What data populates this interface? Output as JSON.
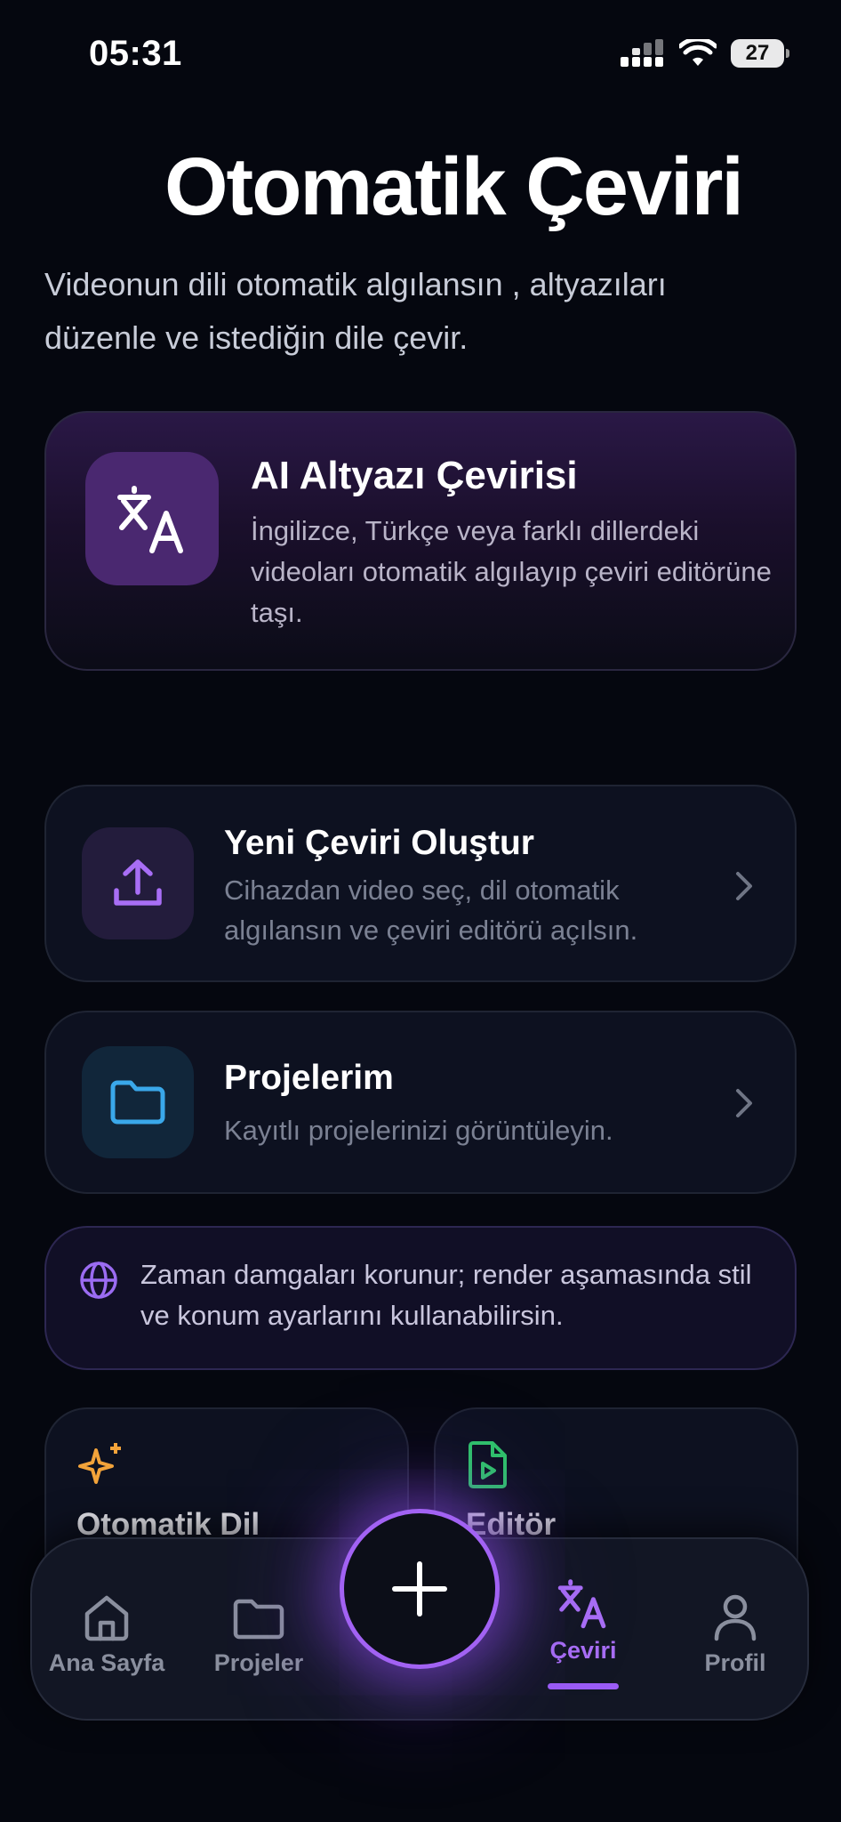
{
  "status": {
    "time": "05:31",
    "battery": "27"
  },
  "header": {
    "title": "Otomatik Çeviri",
    "subtitle": "Videonun dili otomatik algılansın , altyazıları düzenle ve istediğin dile çevir."
  },
  "hero": {
    "title": "AI Altyazı Çevirisi",
    "description": "İngilizce, Türkçe veya farklı dillerdeki videoları otomatik algılayıp çeviri editörüne taşı.",
    "icon": "translate-icon"
  },
  "actions": [
    {
      "title": "Yeni Çeviri Oluştur",
      "description": "Cihazdan video seç, dil otomatik algılansın ve çeviri editörü açılsın.",
      "icon": "upload-icon"
    },
    {
      "title": "Projelerim",
      "description": "Kayıtlı projelerinizi görüntüleyin.",
      "icon": "folder-icon"
    }
  ],
  "info": {
    "text": "Zaman damgaları korunur; render aşamasında stil ve konum ayarlarını kullanabilirsin.",
    "icon": "globe-icon"
  },
  "features": [
    {
      "title": "Otomatik Dil",
      "icon": "sparkles-icon",
      "color": "#f2a33a"
    },
    {
      "title": "Editör",
      "icon": "video-file-icon",
      "color": "#2fc36a"
    }
  ],
  "nav": {
    "items": [
      {
        "label": "Ana Sayfa",
        "icon": "home-icon"
      },
      {
        "label": "Projeler",
        "icon": "folder-icon"
      },
      {
        "label": "Çeviri",
        "icon": "translate-icon",
        "active": true
      },
      {
        "label": "Profil",
        "icon": "person-icon"
      }
    ],
    "fab_icon": "plus-icon"
  },
  "colors": {
    "accent": "#a262f3",
    "background": "#05070f",
    "card": "#0d1120"
  }
}
